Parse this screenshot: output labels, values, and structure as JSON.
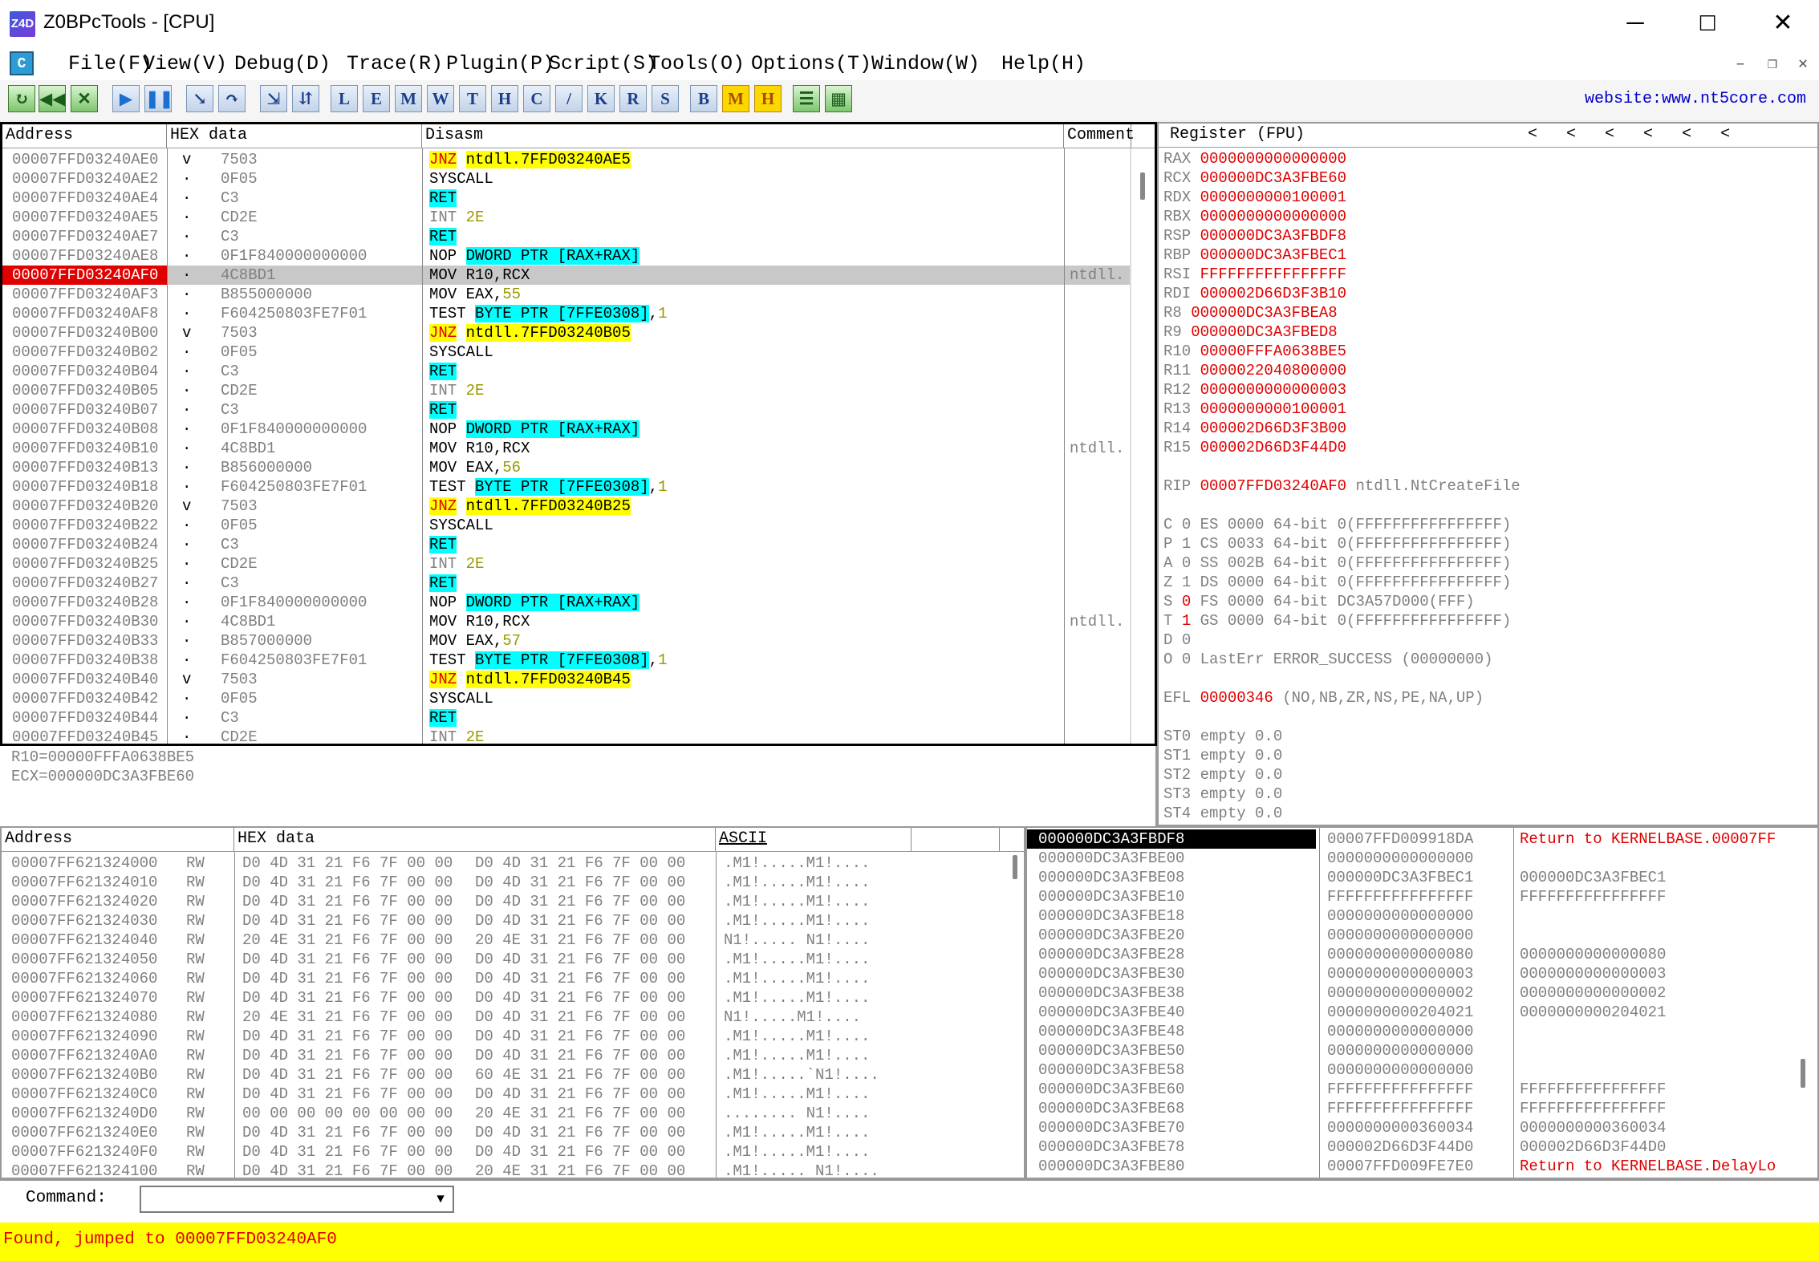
{
  "titlebar": {
    "logo": "Z4D",
    "title": "Z0BPcTools - [CPU]",
    "minimize": "─",
    "maximize": "☐",
    "close": "✕"
  },
  "menubar": {
    "app_icon": "C",
    "items": [
      "File(F)",
      "View(V)",
      "Debug(D)",
      "Trace(R)",
      "Plugin(P)",
      "Script(S)",
      "Tools(O)",
      "Options(T)",
      "Window(W)",
      "Help(H)"
    ],
    "mdi_min": "–",
    "mdi_restore": "❐",
    "mdi_close": "✕"
  },
  "toolbar": {
    "icons": [
      "open-icon",
      "restart-icon",
      "close-icon",
      "run-icon",
      "pause-icon",
      "step-into-icon",
      "step-over-icon",
      "trace-into-icon",
      "trace-over-icon"
    ],
    "letters": [
      "L",
      "E",
      "M",
      "W",
      "T",
      "H",
      "C",
      "/",
      "K",
      "R",
      "S",
      "B",
      "M",
      "H"
    ],
    "extra_icons": [
      "list-icon",
      "grid-icon"
    ],
    "website": "website:www.nt5core.com"
  },
  "cpu": {
    "headers": [
      "Address",
      "HEX data",
      "Disasm",
      "Comment"
    ],
    "rows": [
      {
        "addr": "00007FFD03240AE0",
        "mark": "v",
        "hex": "7503",
        "dis": [
          [
            "j",
            "JNZ"
          ],
          [
            "t",
            " "
          ],
          [
            "y",
            "ntdll.7FFD03240AE5"
          ]
        ],
        "comment": ""
      },
      {
        "addr": "00007FFD03240AE2",
        "mark": "·",
        "hex": "0F05",
        "dis": [
          [
            "t",
            "SYSCALL"
          ]
        ],
        "comment": ""
      },
      {
        "addr": "00007FFD03240AE4",
        "mark": "·",
        "hex": "C3",
        "dis": [
          [
            "c",
            "RET"
          ]
        ],
        "comment": ""
      },
      {
        "addr": "00007FFD03240AE5",
        "mark": "·",
        "hex": "CD2E",
        "dis": [
          [
            "g",
            "INT "
          ],
          [
            "n",
            "2E"
          ]
        ],
        "comment": ""
      },
      {
        "addr": "00007FFD03240AE7",
        "mark": "·",
        "hex": "C3",
        "dis": [
          [
            "c",
            "RET"
          ]
        ],
        "comment": ""
      },
      {
        "addr": "00007FFD03240AE8",
        "mark": "·",
        "hex": "0F1F840000000000",
        "dis": [
          [
            "t",
            "NOP "
          ],
          [
            "c",
            "DWORD PTR [RAX+RAX]"
          ]
        ],
        "comment": ""
      },
      {
        "addr": "00007FFD03240AF0",
        "mark": "·",
        "hex": "4C8BD1",
        "dis": [
          [
            "t",
            "MOV R10,RCX"
          ]
        ],
        "comment": "ntdll.",
        "sel": true
      },
      {
        "addr": "00007FFD03240AF3",
        "mark": "·",
        "hex": "B855000000",
        "dis": [
          [
            "t",
            "MOV EAX,"
          ],
          [
            "n",
            "55"
          ]
        ],
        "comment": ""
      },
      {
        "addr": "00007FFD03240AF8",
        "mark": "·",
        "hex": "F604250803FE7F01",
        "dis": [
          [
            "t",
            "TEST "
          ],
          [
            "c",
            "BYTE PTR [7FFE0308]"
          ],
          [
            "t",
            ","
          ],
          [
            "n",
            "1"
          ]
        ],
        "comment": ""
      },
      {
        "addr": "00007FFD03240B00",
        "mark": "v",
        "hex": "7503",
        "dis": [
          [
            "j",
            "JNZ"
          ],
          [
            "t",
            " "
          ],
          [
            "y",
            "ntdll.7FFD03240B05"
          ]
        ],
        "comment": ""
      },
      {
        "addr": "00007FFD03240B02",
        "mark": "·",
        "hex": "0F05",
        "dis": [
          [
            "t",
            "SYSCALL"
          ]
        ],
        "comment": ""
      },
      {
        "addr": "00007FFD03240B04",
        "mark": "·",
        "hex": "C3",
        "dis": [
          [
            "c",
            "RET"
          ]
        ],
        "comment": ""
      },
      {
        "addr": "00007FFD03240B05",
        "mark": "·",
        "hex": "CD2E",
        "dis": [
          [
            "g",
            "INT "
          ],
          [
            "n",
            "2E"
          ]
        ],
        "comment": ""
      },
      {
        "addr": "00007FFD03240B07",
        "mark": "·",
        "hex": "C3",
        "dis": [
          [
            "c",
            "RET"
          ]
        ],
        "comment": ""
      },
      {
        "addr": "00007FFD03240B08",
        "mark": "·",
        "hex": "0F1F840000000000",
        "dis": [
          [
            "t",
            "NOP "
          ],
          [
            "c",
            "DWORD PTR [RAX+RAX]"
          ]
        ],
        "comment": ""
      },
      {
        "addr": "00007FFD03240B10",
        "mark": "·",
        "hex": "4C8BD1",
        "dis": [
          [
            "t",
            "MOV R10,RCX"
          ]
        ],
        "comment": "ntdll."
      },
      {
        "addr": "00007FFD03240B13",
        "mark": "·",
        "hex": "B856000000",
        "dis": [
          [
            "t",
            "MOV EAX,"
          ],
          [
            "n",
            "56"
          ]
        ],
        "comment": ""
      },
      {
        "addr": "00007FFD03240B18",
        "mark": "·",
        "hex": "F604250803FE7F01",
        "dis": [
          [
            "t",
            "TEST "
          ],
          [
            "c",
            "BYTE PTR [7FFE0308]"
          ],
          [
            "t",
            ","
          ],
          [
            "n",
            "1"
          ]
        ],
        "comment": ""
      },
      {
        "addr": "00007FFD03240B20",
        "mark": "v",
        "hex": "7503",
        "dis": [
          [
            "j",
            "JNZ"
          ],
          [
            "t",
            " "
          ],
          [
            "y",
            "ntdll.7FFD03240B25"
          ]
        ],
        "comment": ""
      },
      {
        "addr": "00007FFD03240B22",
        "mark": "·",
        "hex": "0F05",
        "dis": [
          [
            "t",
            "SYSCALL"
          ]
        ],
        "comment": ""
      },
      {
        "addr": "00007FFD03240B24",
        "mark": "·",
        "hex": "C3",
        "dis": [
          [
            "c",
            "RET"
          ]
        ],
        "comment": ""
      },
      {
        "addr": "00007FFD03240B25",
        "mark": "·",
        "hex": "CD2E",
        "dis": [
          [
            "g",
            "INT "
          ],
          [
            "n",
            "2E"
          ]
        ],
        "comment": ""
      },
      {
        "addr": "00007FFD03240B27",
        "mark": "·",
        "hex": "C3",
        "dis": [
          [
            "c",
            "RET"
          ]
        ],
        "comment": ""
      },
      {
        "addr": "00007FFD03240B28",
        "mark": "·",
        "hex": "0F1F840000000000",
        "dis": [
          [
            "t",
            "NOP "
          ],
          [
            "c",
            "DWORD PTR [RAX+RAX]"
          ]
        ],
        "comment": ""
      },
      {
        "addr": "00007FFD03240B30",
        "mark": "·",
        "hex": "4C8BD1",
        "dis": [
          [
            "t",
            "MOV R10,RCX"
          ]
        ],
        "comment": "ntdll."
      },
      {
        "addr": "00007FFD03240B33",
        "mark": "·",
        "hex": "B857000000",
        "dis": [
          [
            "t",
            "MOV EAX,"
          ],
          [
            "n",
            "57"
          ]
        ],
        "comment": ""
      },
      {
        "addr": "00007FFD03240B38",
        "mark": "·",
        "hex": "F604250803FE7F01",
        "dis": [
          [
            "t",
            "TEST "
          ],
          [
            "c",
            "BYTE PTR [7FFE0308]"
          ],
          [
            "t",
            ","
          ],
          [
            "n",
            "1"
          ]
        ],
        "comment": ""
      },
      {
        "addr": "00007FFD03240B40",
        "mark": "v",
        "hex": "7503",
        "dis": [
          [
            "j",
            "JNZ"
          ],
          [
            "t",
            " "
          ],
          [
            "y",
            "ntdll.7FFD03240B45"
          ]
        ],
        "comment": ""
      },
      {
        "addr": "00007FFD03240B42",
        "mark": "·",
        "hex": "0F05",
        "dis": [
          [
            "t",
            "SYSCALL"
          ]
        ],
        "comment": ""
      },
      {
        "addr": "00007FFD03240B44",
        "mark": "·",
        "hex": "C3",
        "dis": [
          [
            "c",
            "RET"
          ]
        ],
        "comment": ""
      },
      {
        "addr": "00007FFD03240B45",
        "mark": "·",
        "hex": "CD2E",
        "dis": [
          [
            "g",
            "INT "
          ],
          [
            "n",
            "2E"
          ]
        ],
        "comment": ""
      }
    ]
  },
  "info": {
    "lines": [
      "R10=00000FFFA0638BE5",
      "ECX=000000DC3A3FBE60"
    ]
  },
  "registers": {
    "header": "Register (FPU)",
    "nav": [
      "<",
      "<",
      "<",
      "<",
      "<",
      "<"
    ],
    "gpr": [
      [
        "RAX",
        "0000000000000000"
      ],
      [
        "RCX",
        "000000DC3A3FBE60"
      ],
      [
        "RDX",
        "0000000000100001"
      ],
      [
        "RBX",
        "0000000000000000"
      ],
      [
        "RSP",
        "000000DC3A3FBDF8"
      ],
      [
        "RBP",
        "000000DC3A3FBEC1"
      ],
      [
        "RSI",
        "FFFFFFFFFFFFFFFF"
      ],
      [
        "RDI",
        "000002D66D3F3B10"
      ],
      [
        "R8",
        "000000DC3A3FBEA8"
      ],
      [
        "R9",
        "000000DC3A3FBED8"
      ],
      [
        "R10",
        "00000FFFA0638BE5"
      ],
      [
        "R11",
        "0000022040800000"
      ],
      [
        "R12",
        "0000000000000003"
      ],
      [
        "R13",
        "0000000000100001"
      ],
      [
        "R14",
        "000002D66D3F3B00"
      ],
      [
        "R15",
        "000002D66D3F44D0"
      ]
    ],
    "rip": [
      "RIP",
      "00007FFD03240AF0",
      "ntdll.NtCreateFile"
    ],
    "flags": [
      [
        "C",
        "0",
        "ES 0000 64-bit 0(FFFFFFFFFFFFFFFF)"
      ],
      [
        "P",
        "1",
        "CS 0033 64-bit 0(FFFFFFFFFFFFFFFF)"
      ],
      [
        "A",
        "0",
        "SS 002B 64-bit 0(FFFFFFFFFFFFFFFF)"
      ],
      [
        "Z",
        "1",
        "DS 0000 64-bit 0(FFFFFFFFFFFFFFFF)"
      ],
      [
        "S",
        "0",
        "FS 0000 64-bit DC3A57D000(FFF)"
      ],
      [
        "T",
        "1",
        "GS 0000 64-bit 0(FFFFFFFFFFFFFFFF)"
      ],
      [
        "D",
        "0",
        ""
      ],
      [
        "O",
        "0",
        "LastErr ERROR_SUCCESS (00000000)"
      ]
    ],
    "efl": [
      "EFL",
      "00000346",
      "(NO,NB,ZR,NS,PE,NA,UP)"
    ],
    "fpu": [
      "ST0 empty 0.0",
      "ST1 empty 0.0",
      "ST2 empty 0.0",
      "ST3 empty 0.0",
      "ST4 empty 0.0"
    ]
  },
  "dump": {
    "headers": [
      "Address",
      "HEX data",
      "ASCII"
    ],
    "rows": [
      [
        "00007FF621324000",
        "RW",
        "D0 4D 31 21 F6 7F 00 00",
        "D0 4D 31 21 F6 7F 00 00",
        ".M1!.....M1!...."
      ],
      [
        "00007FF621324010",
        "RW",
        "D0 4D 31 21 F6 7F 00 00",
        "D0 4D 31 21 F6 7F 00 00",
        ".M1!.....M1!...."
      ],
      [
        "00007FF621324020",
        "RW",
        "D0 4D 31 21 F6 7F 00 00",
        "D0 4D 31 21 F6 7F 00 00",
        ".M1!.....M1!...."
      ],
      [
        "00007FF621324030",
        "RW",
        "D0 4D 31 21 F6 7F 00 00",
        "D0 4D 31 21 F6 7F 00 00",
        ".M1!.....M1!...."
      ],
      [
        "00007FF621324040",
        "RW",
        "20 4E 31 21 F6 7F 00 00",
        "20 4E 31 21 F6 7F 00 00",
        " N1!..... N1!...."
      ],
      [
        "00007FF621324050",
        "RW",
        "D0 4D 31 21 F6 7F 00 00",
        "D0 4D 31 21 F6 7F 00 00",
        ".M1!.....M1!...."
      ],
      [
        "00007FF621324060",
        "RW",
        "D0 4D 31 21 F6 7F 00 00",
        "D0 4D 31 21 F6 7F 00 00",
        ".M1!.....M1!...."
      ],
      [
        "00007FF621324070",
        "RW",
        "D0 4D 31 21 F6 7F 00 00",
        "D0 4D 31 21 F6 7F 00 00",
        ".M1!.....M1!...."
      ],
      [
        "00007FF621324080",
        "RW",
        "20 4E 31 21 F6 7F 00 00",
        "D0 4D 31 21 F6 7F 00 00",
        " N1!.....M1!...."
      ],
      [
        "00007FF621324090",
        "RW",
        "D0 4D 31 21 F6 7F 00 00",
        "D0 4D 31 21 F6 7F 00 00",
        ".M1!.....M1!...."
      ],
      [
        "00007FF6213240A0",
        "RW",
        "D0 4D 31 21 F6 7F 00 00",
        "D0 4D 31 21 F6 7F 00 00",
        ".M1!.....M1!...."
      ],
      [
        "00007FF6213240B0",
        "RW",
        "D0 4D 31 21 F6 7F 00 00",
        "60 4E 31 21 F6 7F 00 00",
        ".M1!.....`N1!...."
      ],
      [
        "00007FF6213240C0",
        "RW",
        "D0 4D 31 21 F6 7F 00 00",
        "D0 4D 31 21 F6 7F 00 00",
        ".M1!.....M1!...."
      ],
      [
        "00007FF6213240D0",
        "RW",
        "00 00 00 00 00 00 00 00",
        "20 4E 31 21 F6 7F 00 00",
        "........ N1!...."
      ],
      [
        "00007FF6213240E0",
        "RW",
        "D0 4D 31 21 F6 7F 00 00",
        "D0 4D 31 21 F6 7F 00 00",
        ".M1!.....M1!...."
      ],
      [
        "00007FF6213240F0",
        "RW",
        "D0 4D 31 21 F6 7F 00 00",
        "D0 4D 31 21 F6 7F 00 00",
        ".M1!.....M1!...."
      ],
      [
        "00007FF621324100",
        "RW",
        "D0 4D 31 21 F6 7F 00 00",
        "20 4E 31 21 F6 7F 00 00",
        ".M1!..... N1!...."
      ]
    ]
  },
  "stack": {
    "rows": [
      [
        "000000DC3A3FBDF8",
        "00007FFD009918DA",
        "Return to KERNELBASE.00007FF"
      ],
      [
        "000000DC3A3FBE00",
        "0000000000000000",
        ""
      ],
      [
        "000000DC3A3FBE08",
        "000000DC3A3FBEC1",
        "000000DC3A3FBEC1"
      ],
      [
        "000000DC3A3FBE10",
        "FFFFFFFFFFFFFFFF",
        "FFFFFFFFFFFFFFFF"
      ],
      [
        "000000DC3A3FBE18",
        "0000000000000000",
        ""
      ],
      [
        "000000DC3A3FBE20",
        "0000000000000000",
        ""
      ],
      [
        "000000DC3A3FBE28",
        "0000000000000080",
        "0000000000000080"
      ],
      [
        "000000DC3A3FBE30",
        "0000000000000003",
        "0000000000000003"
      ],
      [
        "000000DC3A3FBE38",
        "0000000000000002",
        "0000000000000002"
      ],
      [
        "000000DC3A3FBE40",
        "0000000000204021",
        "0000000000204021"
      ],
      [
        "000000DC3A3FBE48",
        "0000000000000000",
        ""
      ],
      [
        "000000DC3A3FBE50",
        "0000000000000000",
        ""
      ],
      [
        "000000DC3A3FBE58",
        "0000000000000000",
        ""
      ],
      [
        "000000DC3A3FBE60",
        "FFFFFFFFFFFFFFFF",
        "FFFFFFFFFFFFFFFF"
      ],
      [
        "000000DC3A3FBE68",
        "FFFFFFFFFFFFFFFF",
        "FFFFFFFFFFFFFFFF"
      ],
      [
        "000000DC3A3FBE70",
        "0000000000360034",
        "0000000000360034"
      ],
      [
        "000000DC3A3FBE78",
        "000002D66D3F44D0",
        "000002D66D3F44D0"
      ],
      [
        "000000DC3A3FBE80",
        "00007FFD009FE7E0",
        "Return to KERNELBASE.DelayLo"
      ]
    ]
  },
  "command": {
    "label": "Command:",
    "value": "",
    "dropdown": "▼"
  },
  "status": {
    "text": "Found, jumped to 00007FFD03240AF0"
  },
  "colors": {
    "status_bg": "#ffff00",
    "status_fg": "#e00000",
    "cyan": "#00ffff",
    "yellow": "#ffff00",
    "sel_addr": "#e00000"
  }
}
